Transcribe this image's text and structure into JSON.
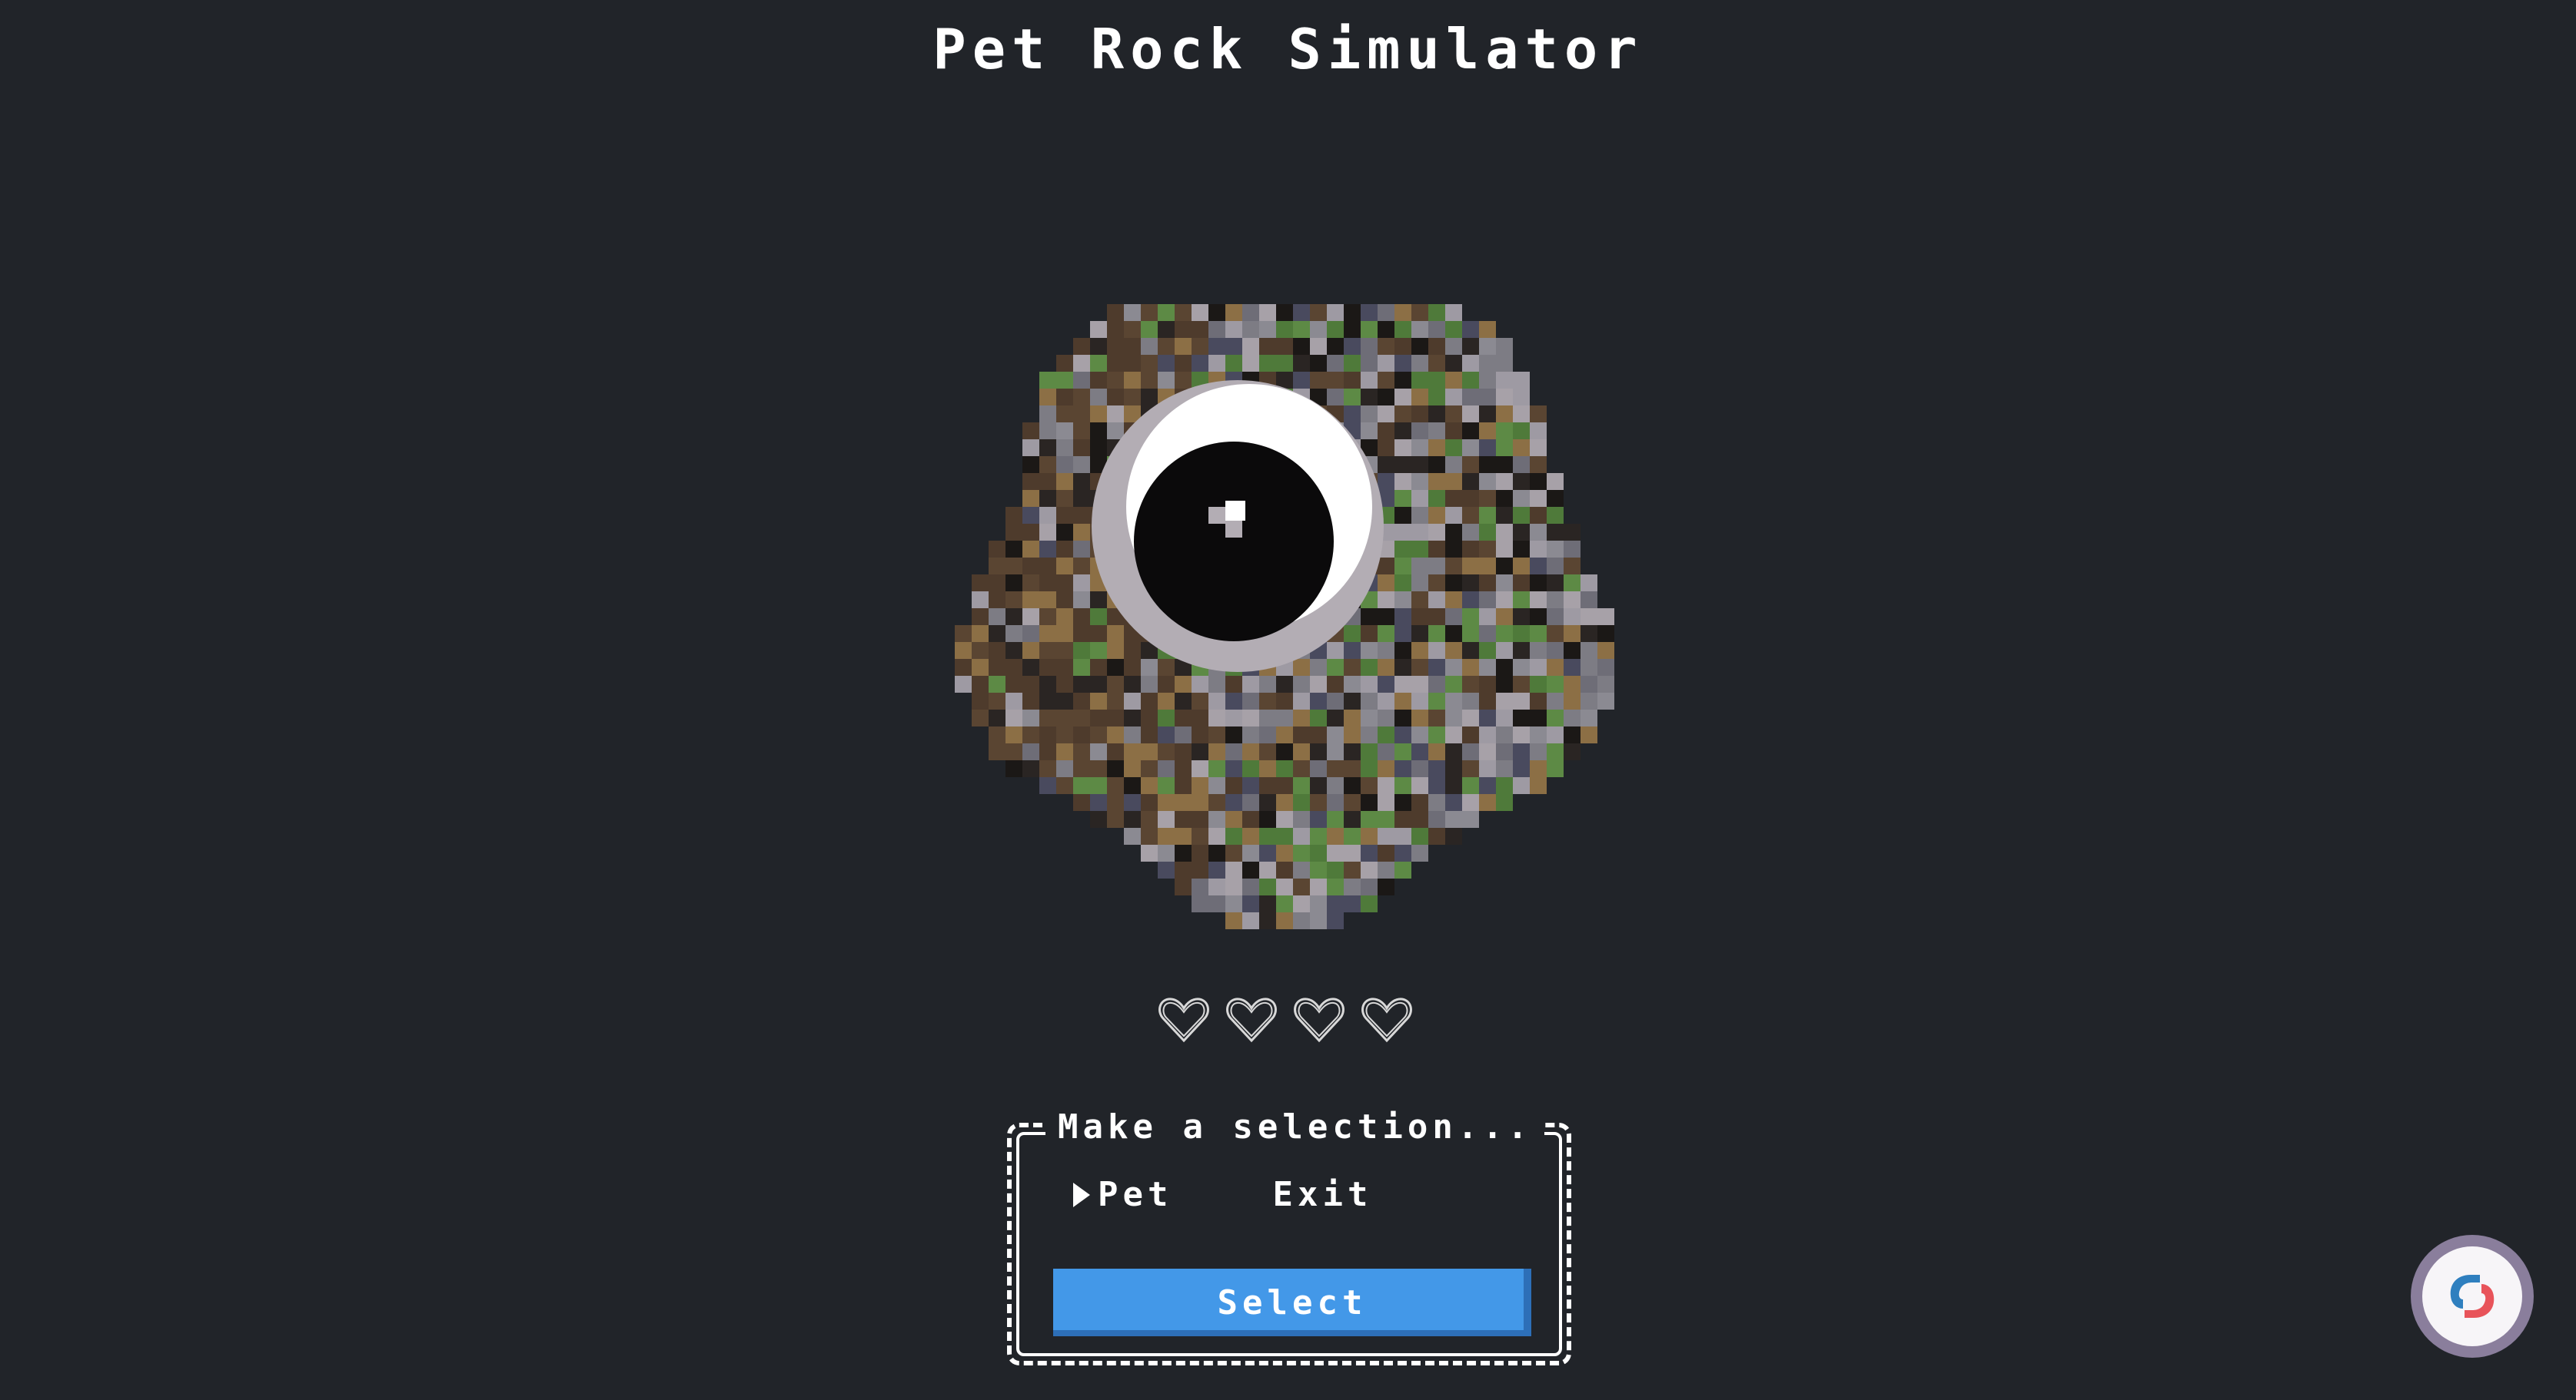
{
  "app": {
    "title": "Pet Rock Simulator"
  },
  "pet": {
    "icon": "pixel-rock-with-eye"
  },
  "hearts": {
    "filled": 0,
    "total": 4,
    "icon": "heart-outline-icon"
  },
  "menu": {
    "prompt": "Make a selection...",
    "options": [
      {
        "label": "Pet",
        "selected": true
      },
      {
        "label": "Exit",
        "selected": false
      }
    ],
    "select_label": "Select"
  },
  "widget": {
    "icon": "chat-support-icon"
  },
  "colors": {
    "background": "#212429",
    "accent": "#4398e8",
    "accent_shadow": "#2d6fb8",
    "text": "#ffffff"
  }
}
